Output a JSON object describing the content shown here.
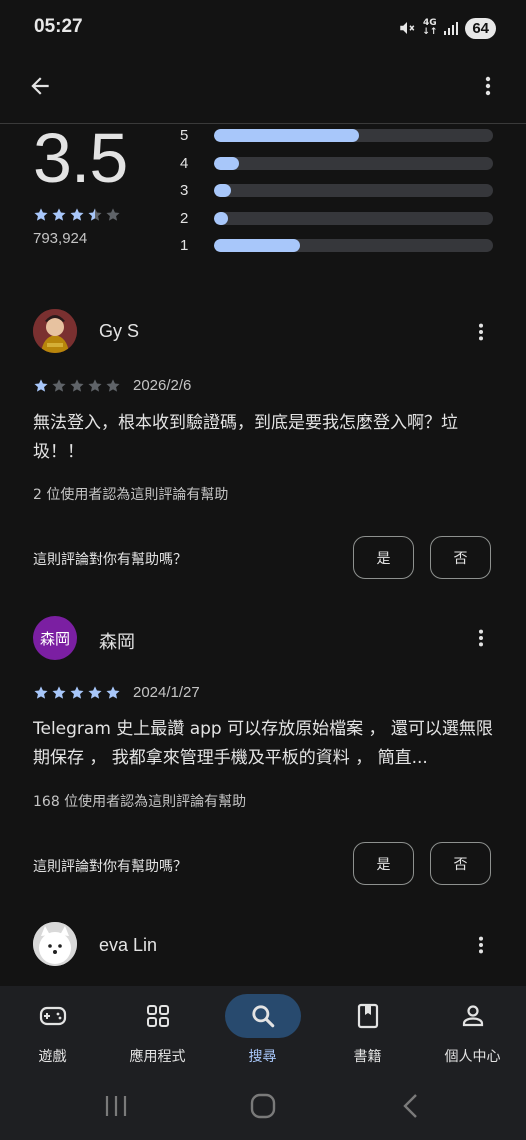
{
  "status_bar": {
    "time": "05:27",
    "network": "4G",
    "battery": "64"
  },
  "rating_summary": {
    "average": "3.5",
    "total_ratings": "793,924",
    "stars_filled": 3.5,
    "distribution": [
      {
        "label": "5",
        "fraction": 0.52
      },
      {
        "label": "4",
        "fraction": 0.09
      },
      {
        "label": "3",
        "fraction": 0.06
      },
      {
        "label": "2",
        "fraction": 0.05
      },
      {
        "label": "1",
        "fraction": 0.31
      }
    ]
  },
  "reviews": [
    {
      "name": "Gy S",
      "rating": 1,
      "date": "2026/2/6",
      "text": "無法登入，根本收到驗證碼，到底是要我怎麼登入啊？垃圾！！",
      "helpful_count": "2 位使用者認為這則評論有幫助",
      "helpful_question": "這則評論對你有幫助嗎？",
      "yes_label": "是",
      "no_label": "否"
    },
    {
      "name": "森岡",
      "avatar_text": "森岡",
      "avatar_color": "#7b1fa2",
      "rating": 5,
      "date": "2024/1/27",
      "text": "Telegram 史上最讚 app 可以存放原始檔案 ， 還可以選無限期保存 ， 我都拿來管理手機及平板的資料 ， 簡直...",
      "helpful_count": "168 位使用者認為這則評論有幫助",
      "helpful_question": "這則評論對你有幫助嗎？",
      "yes_label": "是",
      "no_label": "否"
    },
    {
      "name": "eva Lin"
    }
  ],
  "bottom_nav": [
    {
      "label": "遊戲",
      "icon": "gamepad-icon",
      "active": false
    },
    {
      "label": "應用程式",
      "icon": "apps-grid-icon",
      "active": false
    },
    {
      "label": "搜尋",
      "icon": "search-icon",
      "active": true
    },
    {
      "label": "書籍",
      "icon": "book-icon",
      "active": false
    },
    {
      "label": "個人中心",
      "icon": "person-icon",
      "active": false
    }
  ],
  "colors": {
    "accent": "#a8c7fa",
    "star_empty": "#5f6368",
    "active_pill": "#284a6e"
  }
}
